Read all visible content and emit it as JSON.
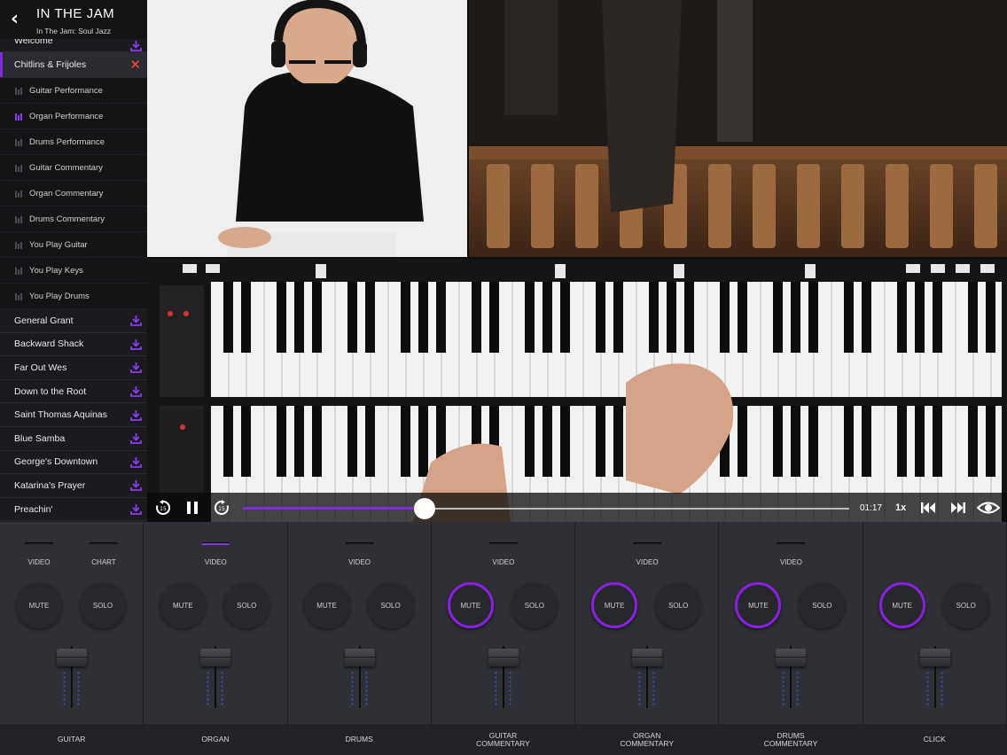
{
  "header": {
    "title": "IN THE JAM",
    "subtitle": "In The Jam: Soul Jazz"
  },
  "songs_top": [
    {
      "label": "Welcome",
      "icon": "download-icon"
    },
    {
      "label": "Chitlins & Frijoles",
      "icon": "close-icon",
      "active": true
    }
  ],
  "parts": [
    {
      "label": "Guitar Performance",
      "playing": false
    },
    {
      "label": "Organ Performance",
      "playing": true
    },
    {
      "label": "Drums Performance",
      "playing": false
    },
    {
      "label": "Guitar Commentary",
      "playing": false
    },
    {
      "label": "Organ Commentary",
      "playing": false
    },
    {
      "label": "Drums Commentary",
      "playing": false
    },
    {
      "label": "You Play Guitar",
      "playing": false
    },
    {
      "label": "You Play Keys",
      "playing": false
    },
    {
      "label": "You Play Drums",
      "playing": false
    }
  ],
  "songs_bottom": [
    {
      "label": "General Grant"
    },
    {
      "label": "Backward Shack"
    },
    {
      "label": "Far Out Wes"
    },
    {
      "label": "Down to the Root"
    },
    {
      "label": "Saint Thomas Aquinas"
    },
    {
      "label": "Blue Samba"
    },
    {
      "label": "George's Downtown"
    },
    {
      "label": "Katarina's Prayer"
    },
    {
      "label": "Preachin'"
    }
  ],
  "player": {
    "time": "01:17",
    "speed": "1x",
    "progress": 0.3
  },
  "colors": {
    "accent": "#7b2be0",
    "close": "#ff4a3a"
  },
  "mixer": {
    "mute_label": "MUTE",
    "solo_label": "SOLO",
    "channels": [
      {
        "name": "GUITAR",
        "toggles": [
          {
            "label": "VIDEO",
            "on": false
          },
          {
            "label": "CHART",
            "on": false
          }
        ],
        "muted": false
      },
      {
        "name": "ORGAN",
        "toggles": [
          {
            "label": "VIDEO",
            "on": true
          }
        ],
        "muted": false
      },
      {
        "name": "DRUMS",
        "toggles": [
          {
            "label": "VIDEO",
            "on": false
          }
        ],
        "muted": false
      },
      {
        "name": "GUITAR\nCOMMENTARY",
        "toggles": [
          {
            "label": "VIDEO",
            "on": false
          }
        ],
        "muted": true
      },
      {
        "name": "ORGAN\nCOMMENTARY",
        "toggles": [
          {
            "label": "VIDEO",
            "on": false
          }
        ],
        "muted": true
      },
      {
        "name": "DRUMS\nCOMMENTARY",
        "toggles": [
          {
            "label": "VIDEO",
            "on": false
          }
        ],
        "muted": true
      },
      {
        "name": "CLICK",
        "toggles": [],
        "muted": true
      }
    ]
  }
}
